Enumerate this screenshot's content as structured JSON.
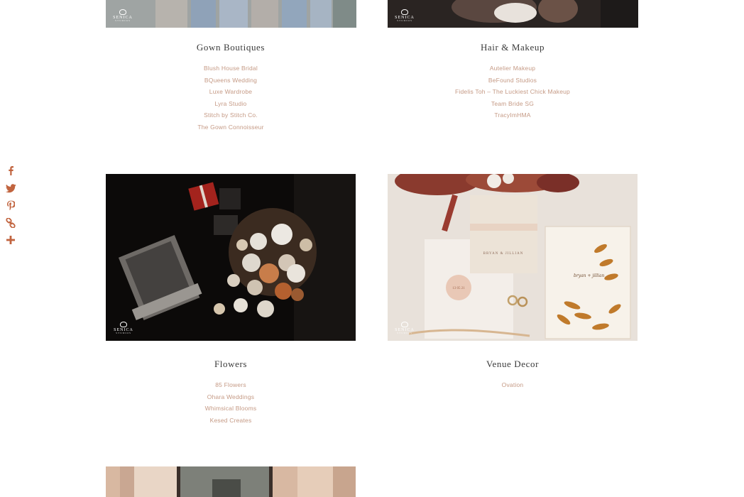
{
  "share": {
    "items": [
      {
        "name": "facebook-icon"
      },
      {
        "name": "twitter-icon"
      },
      {
        "name": "pinterest-icon"
      },
      {
        "name": "copy-link-icon"
      },
      {
        "name": "more-icon"
      }
    ],
    "color": "#c1643f"
  },
  "watermark": {
    "brand": "SENICA",
    "sub": "STUDIOS"
  },
  "colors": {
    "accent": "#c59a85",
    "heading": "#3a3a3a"
  },
  "categories": [
    {
      "title": "Gown Boutiques",
      "vendors": [
        "Blush House Bridal",
        "BQueens Wedding",
        "Luxe Wardrobe",
        "Lyra Studio",
        "Stitch by Stitch Co.",
        "The Gown Connoisseur"
      ]
    },
    {
      "title": "Hair & Makeup",
      "vendors": [
        "Autelier Makeup",
        "BeFound Studios",
        "Fidelis Toh – The Luckiest Chick Makeup",
        "Team Bride SG",
        "TracyImHMA"
      ]
    },
    {
      "title": "Flowers",
      "vendors": [
        "85 Flowers",
        "Ohara Weddings",
        "Whimsical Blooms",
        "Kesed Creates"
      ]
    },
    {
      "title": "Venue Decor",
      "vendors": [
        "Ovation"
      ]
    }
  ],
  "invitation": {
    "names": "BRYAN & JILLIAN",
    "date": "13 05 21",
    "script": "bryan + jillian"
  }
}
